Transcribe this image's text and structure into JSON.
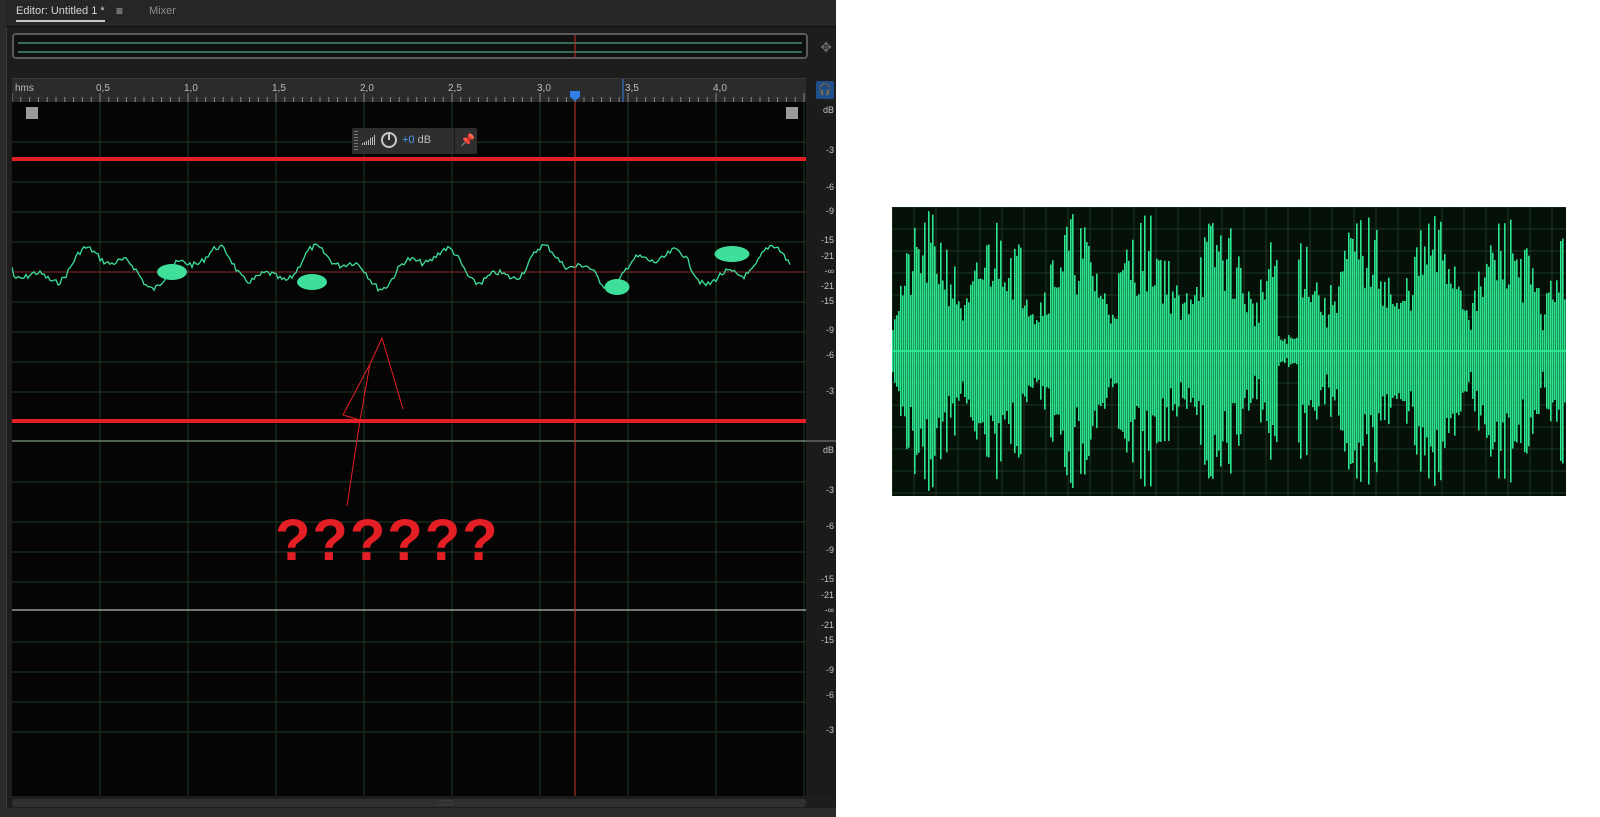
{
  "editor": {
    "tabs": [
      {
        "label": "Editor: Untitled 1 *",
        "active": true
      },
      {
        "label": "Mixer",
        "active": false
      }
    ],
    "tab_menu_icon": "hamburger-icon",
    "overview_grip_icon": "crosshair-icon",
    "headphone_icon": "headphone-icon",
    "ruler": {
      "unit_label": "hms",
      "ticks": [
        "0,5",
        "1,0",
        "1,5",
        "2,0",
        "2,5",
        "3,0",
        "3,5",
        "4,0"
      ]
    },
    "hud": {
      "value": "+0",
      "unit": " dB",
      "knob_icon": "volume-knob-icon",
      "pin_icon": "pin-icon"
    },
    "db_scale": {
      "top_channel": [
        "dB",
        "-3",
        "-6",
        "-9",
        "-15",
        "-21",
        "-∞",
        "-21",
        "-15",
        "-9",
        "-6",
        "-3"
      ],
      "bottom_channel": [
        "dB",
        "-3",
        "-6",
        "-9",
        "-15",
        "-21",
        "-∞",
        "-21",
        "-15",
        "-9",
        "-6",
        "-3"
      ]
    },
    "colors": {
      "waveform": "#3ddf9a",
      "playhead": "#c8322d",
      "grid": "#1d3a24",
      "annotation": "#e31e24",
      "playhead_marker": "#2f7fe6"
    }
  },
  "annotation": {
    "text": "??????"
  },
  "reference_image": {
    "description_icon": "waveform-icon"
  }
}
